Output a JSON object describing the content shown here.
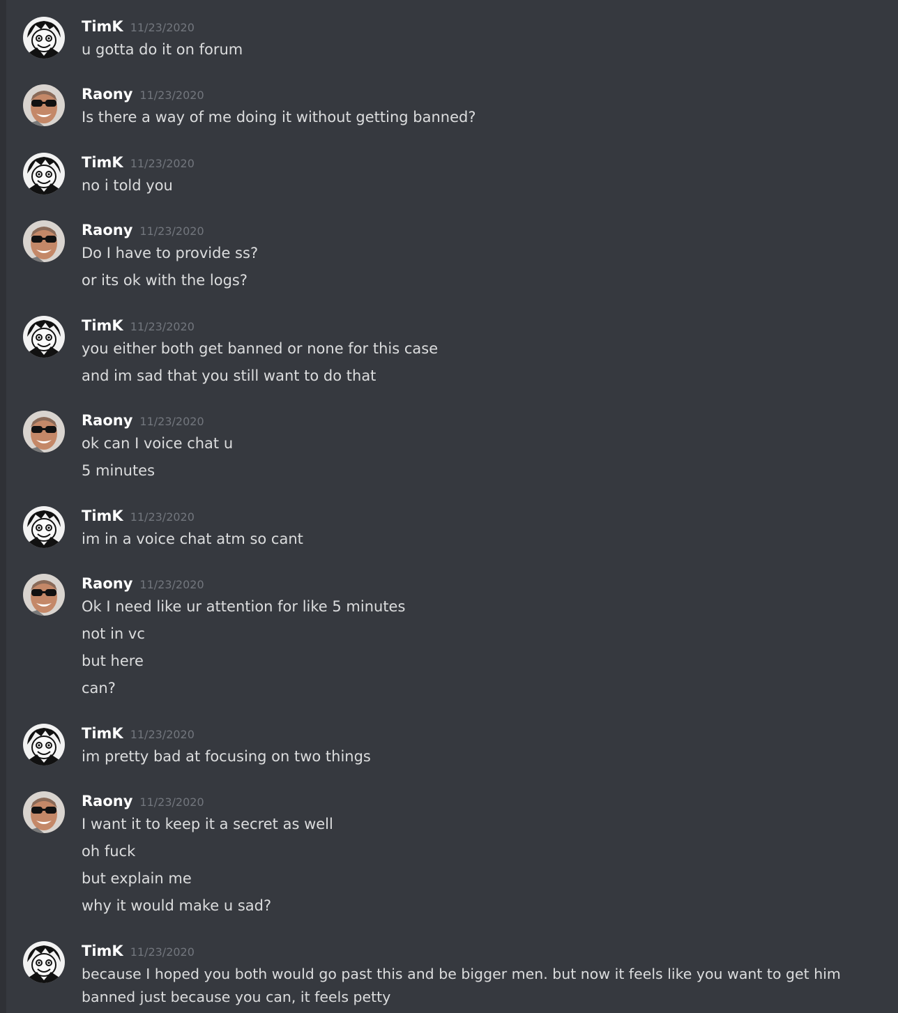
{
  "colors": {
    "background": "#36393f",
    "author": "#ffffff",
    "timestamp": "#72767d",
    "text": "#dcddde"
  },
  "messages": [
    {
      "author": "TimK",
      "avatar": "anime-avatar-icon",
      "timestamp": "11/23/2020",
      "lines": [
        "u gotta do it on forum"
      ]
    },
    {
      "author": "Raony",
      "avatar": "user-photo-avatar",
      "timestamp": "11/23/2020",
      "lines": [
        "Is there a way of me doing it without getting banned?"
      ]
    },
    {
      "author": "TimK",
      "avatar": "anime-avatar-icon",
      "timestamp": "11/23/2020",
      "lines": [
        "no i told you"
      ]
    },
    {
      "author": "Raony",
      "avatar": "user-photo-avatar",
      "timestamp": "11/23/2020",
      "lines": [
        "Do I have to provide ss?",
        "or its ok with the logs?"
      ]
    },
    {
      "author": "TimK",
      "avatar": "anime-avatar-icon",
      "timestamp": "11/23/2020",
      "lines": [
        "you either both get banned or none for this case",
        "and im sad that you still want to do that"
      ]
    },
    {
      "author": "Raony",
      "avatar": "user-photo-avatar",
      "timestamp": "11/23/2020",
      "lines": [
        "ok can I voice chat u",
        "5 minutes"
      ]
    },
    {
      "author": "TimK",
      "avatar": "anime-avatar-icon",
      "timestamp": "11/23/2020",
      "lines": [
        "im in a voice chat atm so cant"
      ]
    },
    {
      "author": "Raony",
      "avatar": "user-photo-avatar",
      "timestamp": "11/23/2020",
      "lines": [
        "Ok I need like ur attention for like 5 minutes",
        "not in vc",
        "but here",
        "can?"
      ]
    },
    {
      "author": "TimK",
      "avatar": "anime-avatar-icon",
      "timestamp": "11/23/2020",
      "lines": [
        "im pretty bad at focusing on two things"
      ]
    },
    {
      "author": "Raony",
      "avatar": "user-photo-avatar",
      "timestamp": "11/23/2020",
      "lines": [
        "I want it to keep it a secret as well",
        "oh fuck",
        "but explain me",
        "why it would make u sad?"
      ]
    },
    {
      "author": "TimK",
      "avatar": "anime-avatar-icon",
      "timestamp": "11/23/2020",
      "lines": [
        "because I hoped you both would go past this and be bigger men. but now it feels like you want to get him banned just because you can, it feels petty"
      ]
    }
  ]
}
